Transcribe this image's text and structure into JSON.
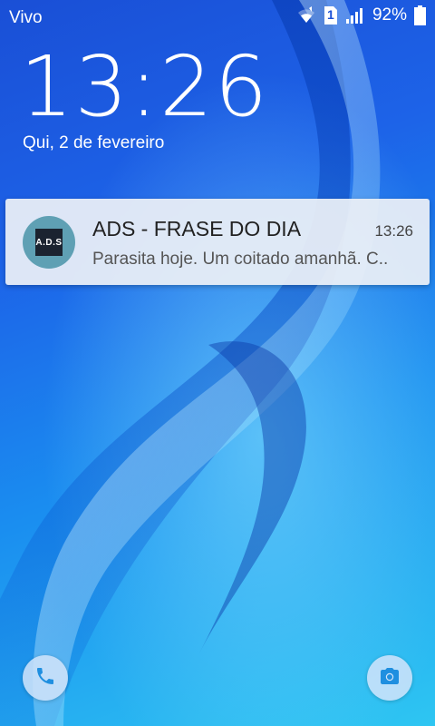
{
  "status_bar": {
    "carrier": "Vivo",
    "sim_badge": "1",
    "battery_percent": "92%"
  },
  "lock_screen": {
    "time": "13:26",
    "date": "Qui, 2 de fevereiro"
  },
  "notification": {
    "icon_label": "A.D.S",
    "title": "ADS - FRASE DO DIA",
    "time": "13:26",
    "text": "Parasita hoje. Um coitado amanhã. C.."
  },
  "shortcuts": {
    "left_icon": "phone-icon",
    "right_icon": "camera-icon"
  },
  "colors": {
    "wallpaper_dark": "#1a4fd6",
    "wallpaper_light": "#2ec6f2",
    "shortcut_icon": "#1f8fe0"
  }
}
